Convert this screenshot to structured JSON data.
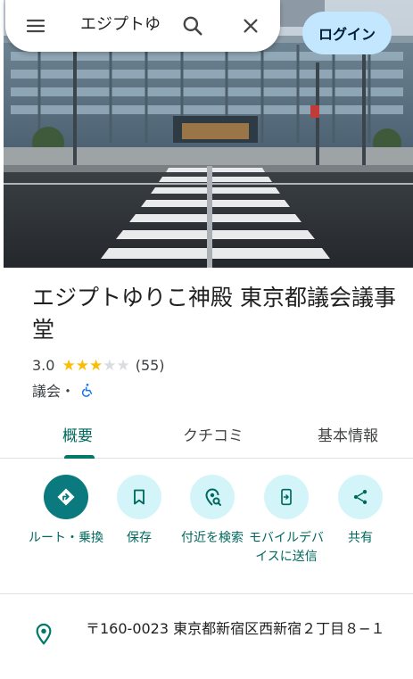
{
  "search": {
    "query": "エジプトゆ"
  },
  "header": {
    "login_label": "ログイン"
  },
  "place": {
    "title": "エジプトゆりこ神殿 東京都議会議事堂",
    "rating": "3.0",
    "rating_value": 3,
    "rating_max": 5,
    "review_count": "(55)",
    "category": "議会・",
    "accessibility_icon": "wheelchair-icon"
  },
  "tabs": [
    {
      "label": "概要",
      "active": true
    },
    {
      "label": "クチコミ",
      "active": false
    },
    {
      "label": "基本情報",
      "active": false
    }
  ],
  "actions": [
    {
      "label": "ルート・乗換",
      "icon": "directions-icon"
    },
    {
      "label": "保存",
      "icon": "bookmark-icon"
    },
    {
      "label": "付近を検索",
      "icon": "nearby-icon"
    },
    {
      "label": "モバイルデバイスに送信",
      "icon": "send-to-phone-icon"
    },
    {
      "label": "共有",
      "icon": "share-icon"
    }
  ],
  "address": {
    "text": "〒160-0023 東京都新宿区西新宿２丁目８−１"
  },
  "colors": {
    "accent": "#00796b",
    "action_bg": "#d3f5f9",
    "action_primary_bg": "#0b7a7e",
    "login_bg": "#c2e7ff",
    "star": "#fbbc04"
  }
}
